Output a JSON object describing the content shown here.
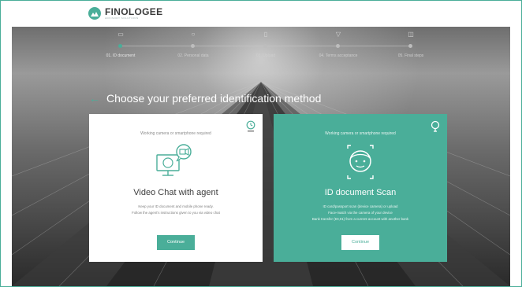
{
  "brand": {
    "name": "FINOLOGEE",
    "tagline": "ADVISORY SOLUTIONS"
  },
  "steps": [
    {
      "label": "01. ID document",
      "icon": "id-card-icon",
      "active": true
    },
    {
      "label": "02. Personal data",
      "icon": "person-icon",
      "active": false
    },
    {
      "label": "03. Upload",
      "icon": "upload-icon",
      "active": false
    },
    {
      "label": "04. Terms acceptance",
      "icon": "terms-icon",
      "active": false
    },
    {
      "label": "05. Final steps",
      "icon": "final-steps-icon",
      "active": false
    }
  ],
  "page": {
    "heading": "Choose your preferred identification method"
  },
  "options": {
    "video": {
      "requirement": "Working camera or smartphone required",
      "title": "Video Chat with agent",
      "desc_1": "Keep your ID document and mobile phone ready.",
      "desc_2": "Follow the agent's instructions given to you via video chat",
      "button": "Continue",
      "corner_icon": "clock-icon"
    },
    "scan": {
      "requirement": "Working camera or smartphone required",
      "title": "ID document Scan",
      "desc_1": "ID card/passport scan (device camera) or upload",
      "desc_2": "Face-match via the camera of your device",
      "desc_3": "Bank transfer (€0,01) from a current account with another bank",
      "button": "Continue",
      "corner_icon": "lightbulb-icon"
    }
  },
  "colors": {
    "accent": "#4aae99",
    "card_white": "#ffffff",
    "text_dark": "#3d3d3d"
  }
}
